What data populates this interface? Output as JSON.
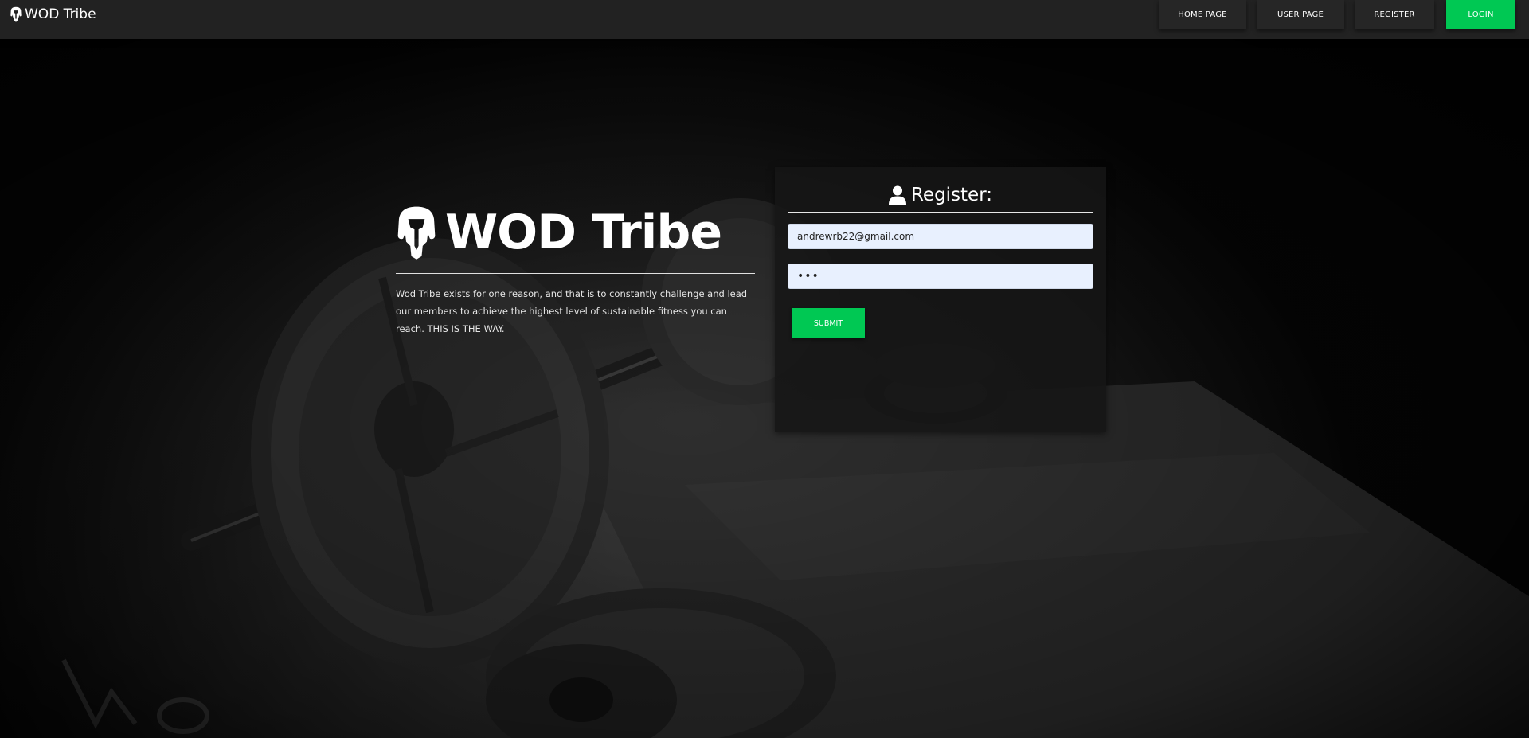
{
  "app": {
    "brand_name": "WOD Tribe",
    "brand_icon": "mandalorian-skull-icon"
  },
  "nav": {
    "items": [
      {
        "label": "HOME PAGE"
      },
      {
        "label": "USER PAGE"
      },
      {
        "label": "REGISTER"
      },
      {
        "label": "LOGIN",
        "active": true
      }
    ]
  },
  "intro": {
    "title": "WOD Tribe",
    "description": "Wod Tribe exists for one reason, and that is to constantly challenge and lead our members to achieve the highest level of sustainable fitness you can reach. THIS IS THE WAY."
  },
  "register": {
    "title": "Register:",
    "icon": "user-icon",
    "email_value": "andrewrb22@gmail.com",
    "password_value": "•••",
    "submit_label": "SUBMIT"
  },
  "colors": {
    "accent": "#00c853",
    "nav_bg": "#222222",
    "input_bg": "#e8f0fe"
  }
}
